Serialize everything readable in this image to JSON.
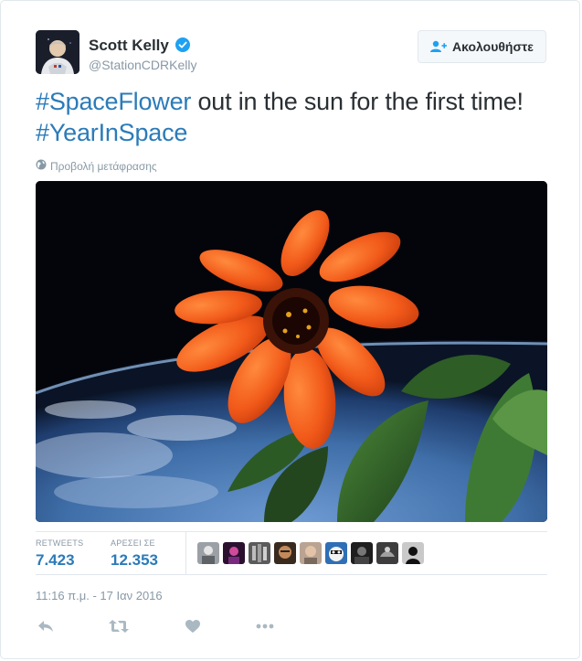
{
  "user": {
    "name": "Scott Kelly",
    "handle": "@StationCDRKelly",
    "verified": true,
    "avatar_icon": "astronaut-avatar"
  },
  "follow_button": {
    "label": "Ακολουθήστε",
    "icon": "add-user-icon"
  },
  "tweet": {
    "segments": [
      {
        "text": "#SpaceFlower",
        "hashtag": true
      },
      {
        "text": " out in the sun for the first time! ",
        "hashtag": false
      },
      {
        "text": "#YearInSpace",
        "hashtag": true
      }
    ],
    "translate_label": "Προβολή μετάφρασης",
    "translate_icon": "globe-icon"
  },
  "media": {
    "icon": "zinnia-flower-photo"
  },
  "stats": {
    "retweets_label": "RETWEETS",
    "retweets_value": "7.423",
    "likes_label": "ΑΡΕΣΕΙ ΣΕ",
    "likes_value": "12.353",
    "liker_count": 9
  },
  "timestamp": "11:16 π.μ. - 17 Ιαν 2016",
  "actions": [
    "reply-icon",
    "retweet-icon",
    "like-icon",
    "more-icon"
  ],
  "colors": {
    "link": "#2b7bb9",
    "muted": "#8899a6",
    "text": "#292f33",
    "verified": "#1da1f2"
  }
}
